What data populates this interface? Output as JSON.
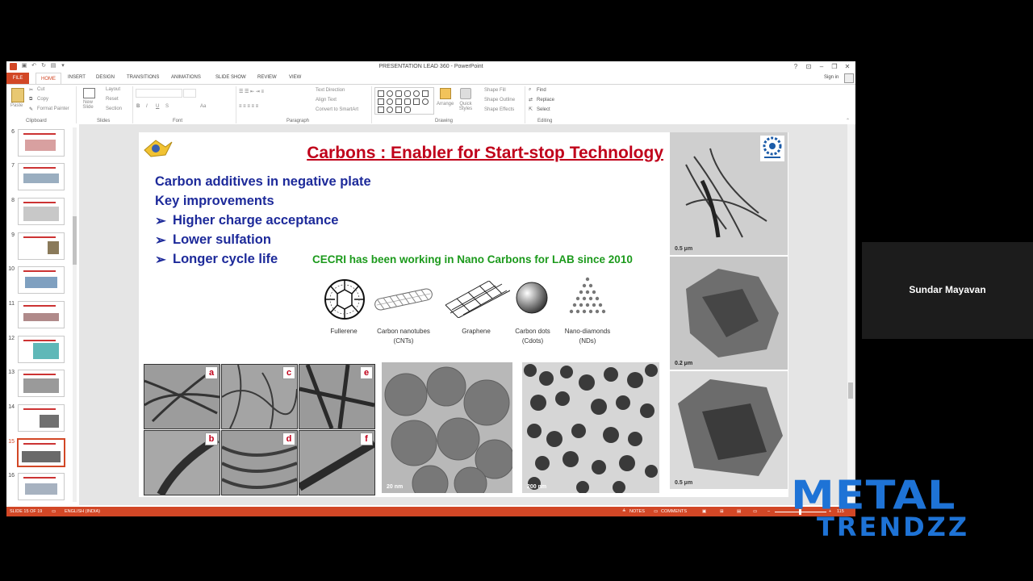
{
  "app": {
    "title": "PRESENTATION LEAD 360 - PowerPoint",
    "sign_in": "Sign in",
    "help_glyph": "?"
  },
  "tabs": [
    "FILE",
    "HOME",
    "INSERT",
    "DESIGN",
    "TRANSITIONS",
    "ANIMATIONS",
    "SLIDE SHOW",
    "REVIEW",
    "VIEW"
  ],
  "ribbon": {
    "clipboard": {
      "paste": "Paste",
      "cut": "Cut",
      "copy": "Copy",
      "format_painter": "Format Painter",
      "group": "Clipboard"
    },
    "slides": {
      "new_slide": "New Slide",
      "layout": "Layout",
      "reset": "Reset",
      "section": "Section",
      "group": "Slides"
    },
    "font": {
      "group": "Font",
      "bold": "B",
      "italic": "I",
      "underline": "U",
      "strike": "S",
      "case": "Aa"
    },
    "paragraph": {
      "group": "Paragraph",
      "text_direction": "Text Direction",
      "align_text": "Align Text",
      "convert": "Convert to SmartArt"
    },
    "drawing": {
      "group": "Drawing",
      "arrange": "Arrange",
      "quick_styles": "Quick Styles",
      "shape_fill": "Shape Fill",
      "shape_outline": "Shape Outline",
      "shape_effects": "Shape Effects"
    },
    "editing": {
      "group": "Editing",
      "find": "Find",
      "replace": "Replace",
      "select": "Select"
    }
  },
  "slide_panel": {
    "numbers": [
      "6",
      "7",
      "8",
      "9",
      "10",
      "11",
      "12",
      "13",
      "14",
      "15",
      "16"
    ],
    "selected": "15"
  },
  "slide": {
    "title": "Carbons : Enabler for Start-stop Technology",
    "line1": "Carbon additives in negative plate",
    "line2": "Key improvements",
    "bullets": [
      "Higher charge acceptance",
      "Lower sulfation",
      "Longer cycle life"
    ],
    "bullet_glyph": "➢",
    "cecri": "CECRI has been working in Nano Carbons for LAB since 2010",
    "carbons": [
      {
        "name": "Fullerene",
        "abbr": ""
      },
      {
        "name": "Carbon nanotubes",
        "abbr": "(CNTs)"
      },
      {
        "name": "Graphene",
        "abbr": ""
      },
      {
        "name": "Carbon dots",
        "abbr": "(Cdots)"
      },
      {
        "name": "Nano-diamonds",
        "abbr": "(NDs)"
      }
    ],
    "micro_letters": [
      "a",
      "c",
      "e",
      "b",
      "d",
      "f"
    ],
    "scale_20nm": "20 nm",
    "scale_200nm": "200 nm",
    "scale_05um": "0.5 μm",
    "scale_02um": "0.2 μm"
  },
  "status": {
    "slide": "SLIDE 15 OF 19",
    "language": "ENGLISH (INDIA)",
    "notes": "NOTES",
    "comments": "COMMENTS",
    "zoom": "115"
  },
  "presenter": {
    "name": "Sundar Mayavan"
  },
  "watermark": {
    "line1": "METAL",
    "line2": "TRENDZZ"
  },
  "colors": {
    "accent": "#d24726",
    "title_red": "#c0001a",
    "body_blue": "#1d2a9a",
    "green": "#1c9a1c",
    "watermark": "#1e73d6"
  }
}
